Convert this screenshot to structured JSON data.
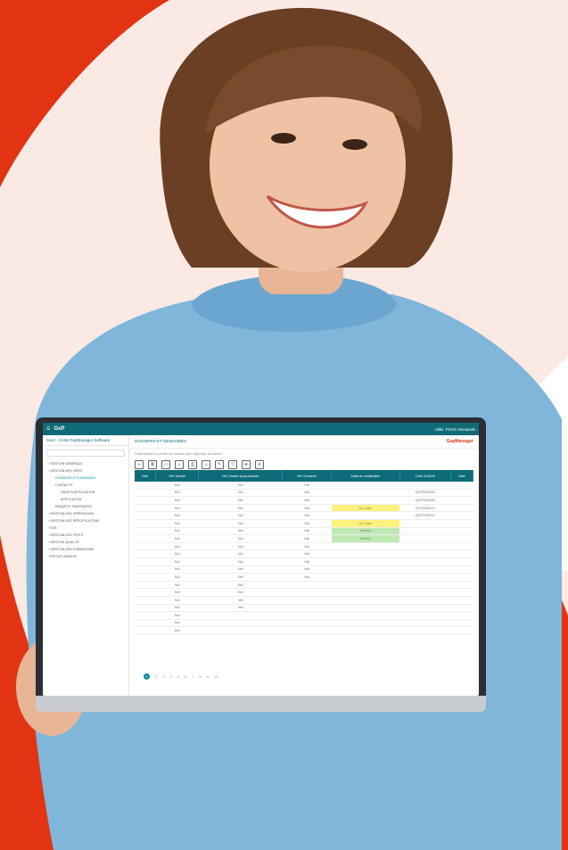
{
  "scene": {
    "background_color": "#fbe9e4",
    "accent_color": "#e23412",
    "description_icons": [
      "person",
      "laptop"
    ]
  },
  "app": {
    "brand": "GxP",
    "user_label": "Utilis. PCHS Demande",
    "header_path": "Suivi - CA56 GxpManager Software",
    "page_title": "DOSSIERS ET DEMANDES",
    "logo": "GxpManager",
    "filter_hint": "Faites glisser ici un titre de colonne pour regrouper la colonne",
    "sidebar": [
      {
        "label": "GESTION GÉNÉRALE",
        "level": 0
      },
      {
        "label": "GESTION DES TIERS",
        "level": 0
      },
      {
        "label": "DOSSIERS ET DEMANDES",
        "level": 1,
        "active": true
      },
      {
        "label": "CONTACTS",
        "level": 1
      },
      {
        "label": "OBJETS APPLICATION",
        "level": 2
      },
      {
        "label": "APPLICATION",
        "level": 2
      },
      {
        "label": "REQUÊTE TRAITEMENT",
        "level": 1
      },
      {
        "label": "GESTION DES OPÉRATIONS",
        "level": 0
      },
      {
        "label": "GESTION DES SPÉCIFICATIONS",
        "level": 0
      },
      {
        "label": "KSS",
        "level": 0
      },
      {
        "label": "GESTION DES TESTS",
        "level": 0
      },
      {
        "label": "GESTION QUALITÉ",
        "level": 0
      },
      {
        "label": "GESTION DES FORMATIONS",
        "level": 0
      },
      {
        "label": "PROJET ANNEXE",
        "level": 0
      }
    ],
    "columns": [
      "Date",
      "Réf. Dossier",
      "Réf. Dossier (sous-dossier)",
      "Réf. Demande",
      "Statut de modification",
      "Code CLASSE",
      "Date"
    ],
    "rows": [
      [
        "",
        "Null",
        "Null",
        "Null",
        "",
        "",
        ""
      ],
      [
        "",
        "Null",
        "Null",
        "Null",
        "",
        "QSP00000006",
        ""
      ],
      [
        "",
        "Null",
        "Null",
        "Null",
        "",
        "QSP00000008",
        ""
      ],
      [
        "",
        "Null",
        "Null",
        "Null",
        "En cours",
        "QSP00000010",
        ""
      ],
      [
        "",
        "Null",
        "Null",
        "Null",
        "",
        "QSP00000012",
        ""
      ],
      [
        "",
        "Null",
        "Null",
        "Null",
        "En cours",
        "",
        ""
      ],
      [
        "",
        "Null",
        "Null",
        "Null",
        "Terminé",
        "",
        ""
      ],
      [
        "",
        "Null",
        "Null",
        "Null",
        "Terminé",
        "",
        ""
      ],
      [
        "",
        "Null",
        "Null",
        "Null",
        "",
        "",
        ""
      ],
      [
        "",
        "Null",
        "Null",
        "Null",
        "",
        "",
        ""
      ],
      [
        "",
        "Null",
        "Null",
        "Null",
        "",
        "",
        ""
      ],
      [
        "",
        "Null",
        "Null",
        "Null",
        "",
        "",
        ""
      ],
      [
        "",
        "Null",
        "Null",
        "Null",
        "",
        "",
        ""
      ],
      [
        "",
        "Null",
        "Null",
        "",
        "",
        "",
        ""
      ],
      [
        "",
        "Null",
        "Null",
        "",
        "",
        "",
        ""
      ],
      [
        "",
        "Null",
        "Null",
        "",
        "",
        "",
        ""
      ],
      [
        "",
        "Null",
        "Null",
        "",
        "",
        "",
        ""
      ],
      [
        "",
        "Null",
        "",
        "",
        "",
        "",
        ""
      ],
      [
        "",
        "Null",
        "",
        "",
        "",
        "",
        ""
      ],
      [
        "",
        "Null",
        "",
        "",
        "",
        "",
        ""
      ]
    ],
    "pager": [
      "1",
      "2",
      "3",
      "4",
      "5",
      "6",
      "7",
      "8",
      "9",
      "10"
    ]
  }
}
